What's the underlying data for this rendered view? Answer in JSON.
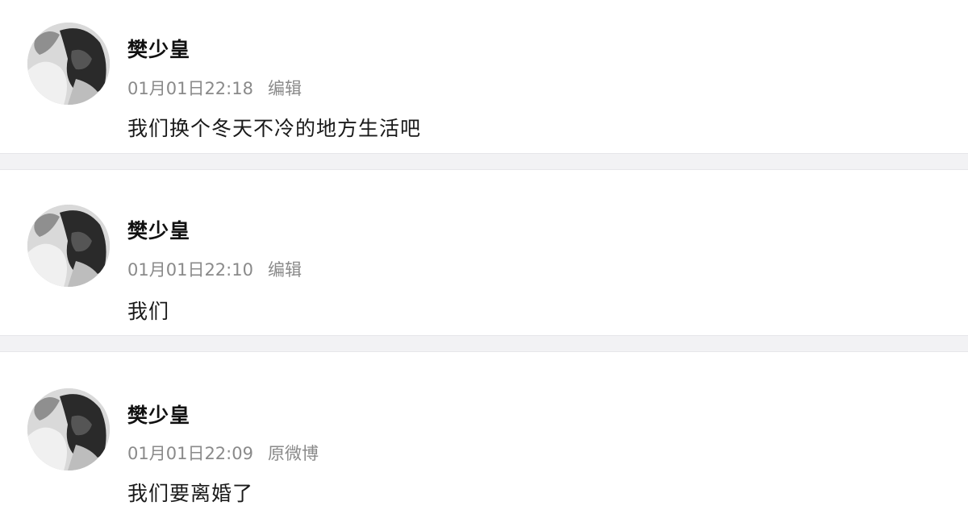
{
  "posts": [
    {
      "author": "樊少皇",
      "time": "01月01日22:18",
      "action": "编辑",
      "text": "我们换个冬天不冷的地方生活吧"
    },
    {
      "author": "樊少皇",
      "time": "01月01日22:10",
      "action": "编辑",
      "text": "我们"
    },
    {
      "author": "樊少皇",
      "time": "01月01日22:09",
      "action": "原微博",
      "text": "我们要离婚了"
    }
  ],
  "colors": {
    "background": "#f2f2f4",
    "card": "#ffffff",
    "meta_text": "#8a8a8a",
    "name_text": "#111111",
    "body_text": "#1a1a1a"
  },
  "icons": {
    "avatar": "avatar-image"
  }
}
